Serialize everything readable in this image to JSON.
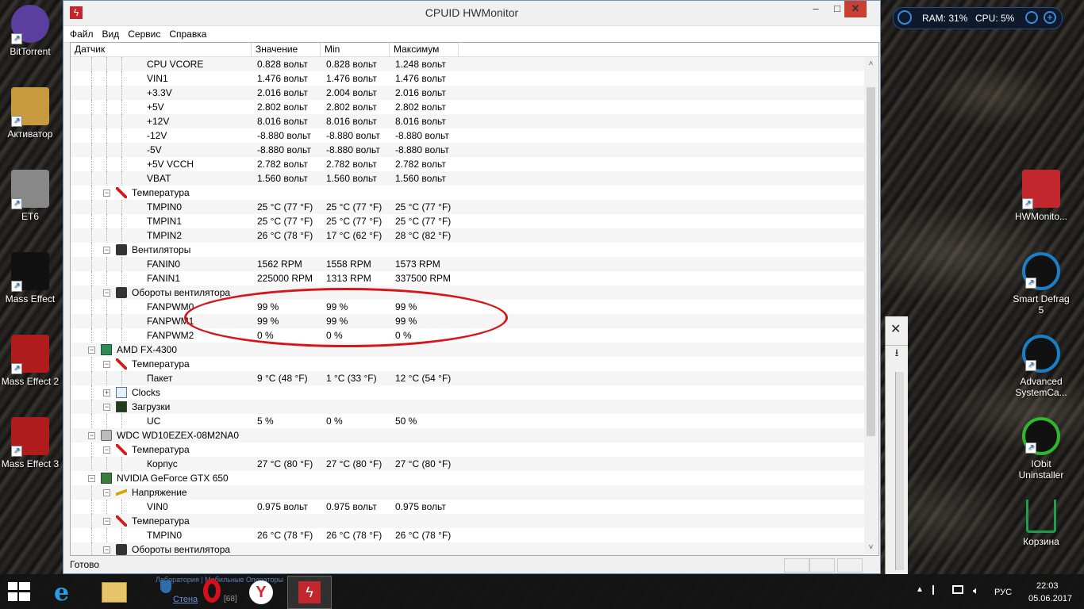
{
  "window": {
    "title": "CPUID HWMonitor",
    "menu": [
      "Файл",
      "Вид",
      "Сервис",
      "Справка"
    ],
    "columns": [
      "Датчик",
      "Значение",
      "Min",
      "Максимум"
    ],
    "status": "Готово",
    "rows": [
      {
        "level": 3,
        "label": "CPU VCORE",
        "val": "0.828 вольт",
        "min": "0.828 вольт",
        "max": "1.248 вольт"
      },
      {
        "level": 3,
        "label": "VIN1",
        "val": "1.476 вольт",
        "min": "1.476 вольт",
        "max": "1.476 вольт"
      },
      {
        "level": 3,
        "label": "+3.3V",
        "val": "2.016 вольт",
        "min": "2.004 вольт",
        "max": "2.016 вольт"
      },
      {
        "level": 3,
        "label": "+5V",
        "val": "2.802 вольт",
        "min": "2.802 вольт",
        "max": "2.802 вольт"
      },
      {
        "level": 3,
        "label": "+12V",
        "val": "8.016 вольт",
        "min": "8.016 вольт",
        "max": "8.016 вольт"
      },
      {
        "level": 3,
        "label": "-12V",
        "val": "-8.880 вольт",
        "min": "-8.880 вольт",
        "max": "-8.880 вольт"
      },
      {
        "level": 3,
        "label": "-5V",
        "val": "-8.880 вольт",
        "min": "-8.880 вольт",
        "max": "-8.880 вольт"
      },
      {
        "level": 3,
        "label": "+5V VCCH",
        "val": "2.782 вольт",
        "min": "2.782 вольт",
        "max": "2.782 вольт"
      },
      {
        "level": 3,
        "label": "VBAT",
        "val": "1.560 вольт",
        "min": "1.560 вольт",
        "max": "1.560 вольт"
      },
      {
        "level": 2,
        "label": "Температура",
        "icon": "thermometer-icon"
      },
      {
        "level": 3,
        "label": "TMPIN0",
        "val": "25 °C  (77 °F)",
        "min": "25 °C  (77 °F)",
        "max": "25 °C  (77 °F)"
      },
      {
        "level": 3,
        "label": "TMPIN1",
        "val": "25 °C  (77 °F)",
        "min": "25 °C  (77 °F)",
        "max": "25 °C  (77 °F)"
      },
      {
        "level": 3,
        "label": "TMPIN2",
        "val": "26 °C  (78 °F)",
        "min": "17 °C  (62 °F)",
        "max": "28 °C  (82 °F)"
      },
      {
        "level": 2,
        "label": "Вентиляторы",
        "icon": "fan-icon"
      },
      {
        "level": 3,
        "label": "FANIN0",
        "val": "1562 RPM",
        "min": "1558 RPM",
        "max": "1573 RPM"
      },
      {
        "level": 3,
        "label": "FANIN1",
        "val": "225000 RPM",
        "min": "1313 RPM",
        "max": "337500 RPM"
      },
      {
        "level": 2,
        "label": "Обороты вентилятора",
        "icon": "fan-icon"
      },
      {
        "level": 3,
        "label": "FANPWM0",
        "val": "99 %",
        "min": "99 %",
        "max": "99 %"
      },
      {
        "level": 3,
        "label": "FANPWM1",
        "val": "99 %",
        "min": "99 %",
        "max": "99 %"
      },
      {
        "level": 3,
        "label": "FANPWM2",
        "val": "0 %",
        "min": "0 %",
        "max": "0 %"
      },
      {
        "level": 1,
        "label": "AMD FX-4300",
        "icon": "cpu-icon"
      },
      {
        "level": 2,
        "label": "Температура",
        "icon": "thermometer-icon"
      },
      {
        "level": 3,
        "label": "Пакет",
        "val": "9 °C  (48 °F)",
        "min": "1 °C  (33 °F)",
        "max": "12 °C  (54 °F)"
      },
      {
        "level": 2,
        "label": "Clocks",
        "icon": "clock-icon",
        "collapsed": true
      },
      {
        "level": 2,
        "label": "Загрузки",
        "icon": "load-icon"
      },
      {
        "level": 3,
        "label": "UC",
        "val": "5 %",
        "min": "0 %",
        "max": "50 %"
      },
      {
        "level": 1,
        "label": "WDC WD10EZEX-08M2NA0",
        "icon": "disk-icon"
      },
      {
        "level": 2,
        "label": "Температура",
        "icon": "thermometer-icon"
      },
      {
        "level": 3,
        "label": "Корпус",
        "val": "27 °C  (80 °F)",
        "min": "27 °C  (80 °F)",
        "max": "27 °C  (80 °F)"
      },
      {
        "level": 1,
        "label": "NVIDIA GeForce GTX 650",
        "icon": "gpu-icon"
      },
      {
        "level": 2,
        "label": "Напряжение",
        "icon": "voltage-icon"
      },
      {
        "level": 3,
        "label": "VIN0",
        "val": "0.975 вольт",
        "min": "0.975 вольт",
        "max": "0.975 вольт"
      },
      {
        "level": 2,
        "label": "Температура",
        "icon": "thermometer-icon"
      },
      {
        "level": 3,
        "label": "TMPIN0",
        "val": "26 °C  (78 °F)",
        "min": "26 °C  (78 °F)",
        "max": "26 °C  (78 °F)"
      },
      {
        "level": 2,
        "label": "Обороты вентилятора",
        "icon": "fan-icon"
      }
    ]
  },
  "desktop_left": [
    {
      "label": "BitTorrent",
      "icon": "bittorrent-icon"
    },
    {
      "label": "Активатор",
      "icon": "activator-icon"
    },
    {
      "label": "ET6",
      "icon": "et6-icon"
    },
    {
      "label": "Mass Effect",
      "icon": "mass-effect-icon"
    },
    {
      "label": "Mass Effect 2",
      "icon": "mass-effect-2-icon"
    },
    {
      "label": "Mass Effect 3",
      "icon": "mass-effect-3-icon"
    }
  ],
  "desktop_right": [
    {
      "label": "HWMonito...",
      "icon": "hwmonitor-icon"
    },
    {
      "label": "Smart Defrag 5",
      "icon": "smart-defrag-icon"
    },
    {
      "label": "Advanced SystemCa...",
      "icon": "advanced-systemcare-icon"
    },
    {
      "label": "IObit Uninstaller",
      "icon": "iobit-uninstaller-icon"
    },
    {
      "label": "Корзина",
      "icon": "recycle-bin-icon"
    }
  ],
  "gadget": {
    "ram": "RAM: 31%",
    "cpu": "CPU: 5%"
  },
  "taskbar": {
    "time": "22:03",
    "date": "05.06.2017",
    "lang": "РУС",
    "behind_text": "Стена",
    "behind_count": "[68]",
    "behind_links": "Лаборатория | Мобильные Операторы"
  },
  "colors": {
    "annotation": "#d8141b",
    "close_button": "#c84031",
    "hwmonitor": "#c1272d"
  }
}
